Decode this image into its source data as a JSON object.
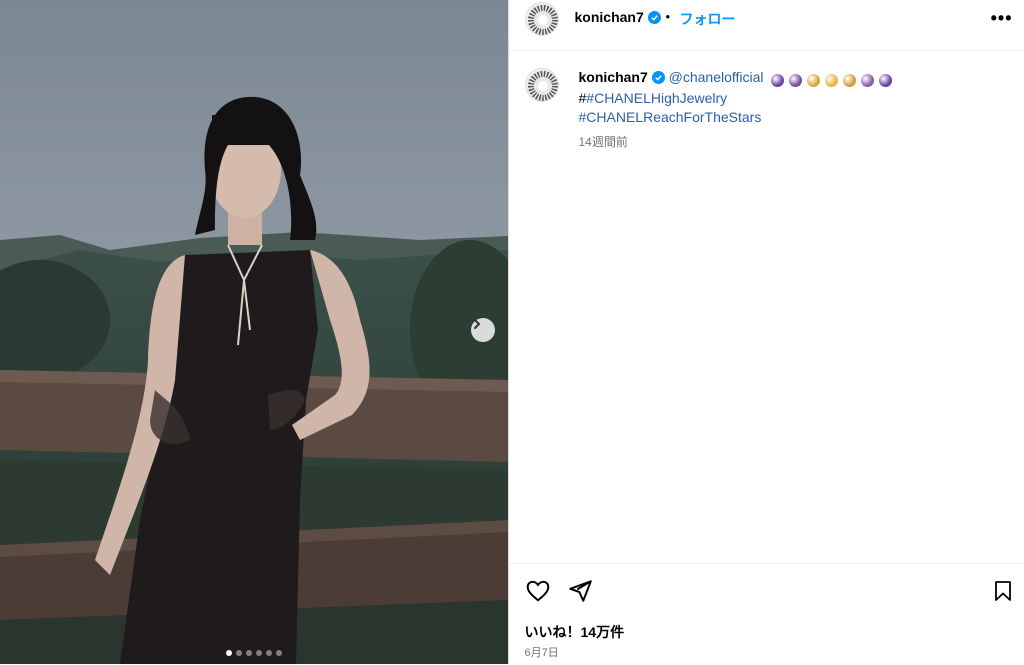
{
  "post": {
    "username": "konichan7",
    "follow_label": "フォロー",
    "separator": "•",
    "more_label": "•••"
  },
  "caption": {
    "username": "konichan7",
    "mention": "@chanelofficial",
    "hash_prefix": "#",
    "hashtag1": "#CHANELHighJewelry",
    "hashtag2": "#CHANELReachForTheStars",
    "moon_colors": [
      "#6a3fa0",
      "#7a4a9e",
      "#d9a53c",
      "#e6b340",
      "#d49a3a",
      "#8a5aa8",
      "#6b3fa3"
    ],
    "time_ago": "14週間前"
  },
  "engagement": {
    "likes": "いいね！14万件",
    "date": "6月7日"
  },
  "carousel": {
    "total": 6,
    "active_index": 0
  },
  "icons": {
    "verified": "verified-badge-icon",
    "next": "chevron-right-icon",
    "like": "heart-icon",
    "share": "paper-plane-icon",
    "save": "bookmark-icon"
  },
  "colors": {
    "accent": "#0095f6",
    "verified": "#0095f6",
    "muted": "#737373"
  }
}
